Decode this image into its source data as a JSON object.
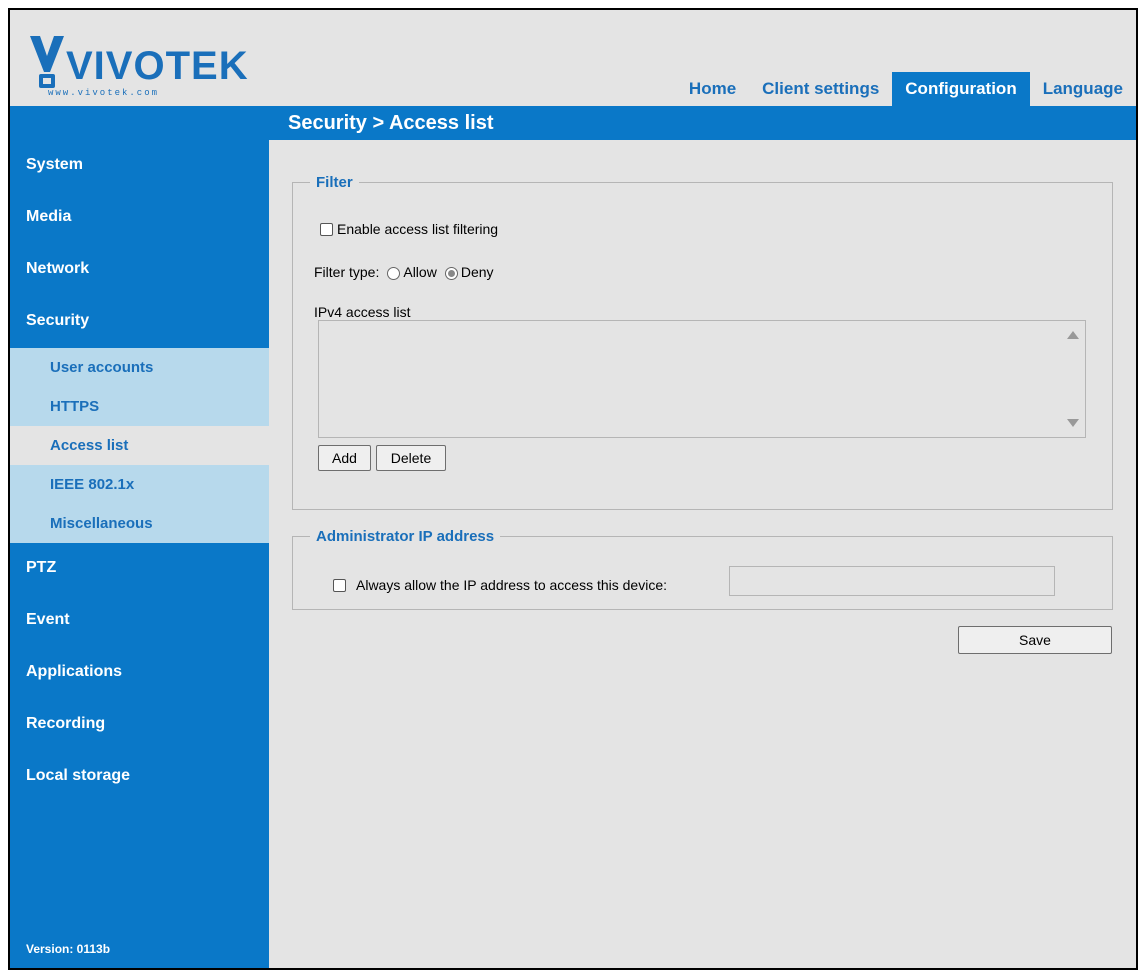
{
  "brand": {
    "name": "VIVOTEK",
    "url": "www.vivotek.com",
    "color": "#1a6fba"
  },
  "topnav": {
    "tabs": [
      {
        "label": "Home",
        "active": false
      },
      {
        "label": "Client settings",
        "active": false
      },
      {
        "label": "Configuration",
        "active": true
      },
      {
        "label": "Language",
        "active": false
      }
    ]
  },
  "breadcrumb": "Security  > Access list",
  "sidebar": {
    "items": [
      {
        "label": "System"
      },
      {
        "label": "Media"
      },
      {
        "label": "Network"
      },
      {
        "label": "Security"
      },
      {
        "label": "PTZ"
      },
      {
        "label": "Event"
      },
      {
        "label": "Applications"
      },
      {
        "label": "Recording"
      },
      {
        "label": "Local storage"
      }
    ],
    "security_subitems": [
      {
        "label": "User accounts",
        "active": false
      },
      {
        "label": "HTTPS",
        "active": false
      },
      {
        "label": "Access list",
        "active": true
      },
      {
        "label": "IEEE 802.1x",
        "active": false
      },
      {
        "label": "Miscellaneous",
        "active": false
      }
    ],
    "version": "Version: 0113b"
  },
  "filter": {
    "legend": "Filter",
    "enable_label": "Enable access list filtering",
    "enable_checked": false,
    "filter_type_label": "Filter type:",
    "allow_label": "Allow",
    "deny_label": "Deny",
    "selected": "Deny",
    "list_label": "IPv4 access list",
    "add_label": "Add",
    "delete_label": "Delete"
  },
  "admin": {
    "legend": "Administrator IP address",
    "always_allow_label": "Always allow the IP address to access this device:",
    "always_allow_checked": false,
    "ip_value": ""
  },
  "save_label": "Save",
  "colors": {
    "primary_blue": "#0a78c8",
    "sub_menu_bg": "#b7d9ec",
    "page_bg": "#e4e4e4"
  }
}
